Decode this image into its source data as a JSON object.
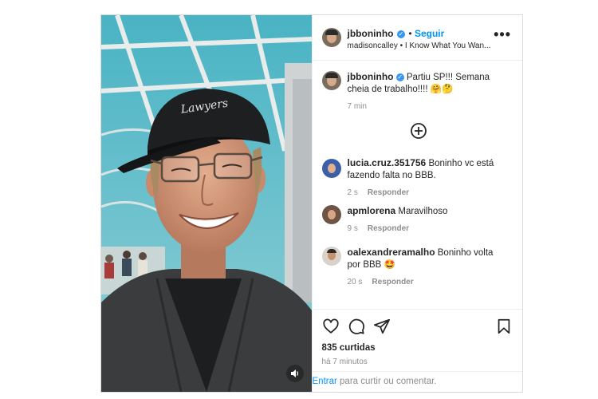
{
  "post": {
    "author": "jbboninho",
    "follow_label": "Seguir",
    "audio_line": "madisoncalley • I Know What You Wan...",
    "caption": "Partiu SP!!! Semana cheia de trabalho!!!! 🤗🤔",
    "caption_time": "7 min",
    "likes": "835 curtidas",
    "posted_ago": "há 7 minutos",
    "cap_text": "Lawyers"
  },
  "comments": [
    {
      "user": "lucia.cruz.351756",
      "text": "Boninho vc está fazendo falta no BBB.",
      "time": "2 s",
      "reply": "Responder"
    },
    {
      "user": "apmlorena",
      "text": "Maravilhoso",
      "time": "9 s",
      "reply": "Responder"
    },
    {
      "user": "oalexandreramalho",
      "text": "Boninho volta por BBB 🤩",
      "time": "20 s",
      "reply": "Responder"
    }
  ],
  "comment_bar": {
    "login_label": "Entrar",
    "prompt": "para curtir ou comentar."
  },
  "icons": {
    "more": "more-options-icon",
    "load_more": "plus-circle-icon",
    "like": "heart-icon",
    "comment": "comment-icon",
    "share": "share-icon",
    "save": "bookmark-icon",
    "sound": "speaker-icon",
    "verified": "verified-badge-icon"
  },
  "colors": {
    "accent": "#0095f6",
    "verified": "#3897f0",
    "muted": "#8e8e8e"
  }
}
